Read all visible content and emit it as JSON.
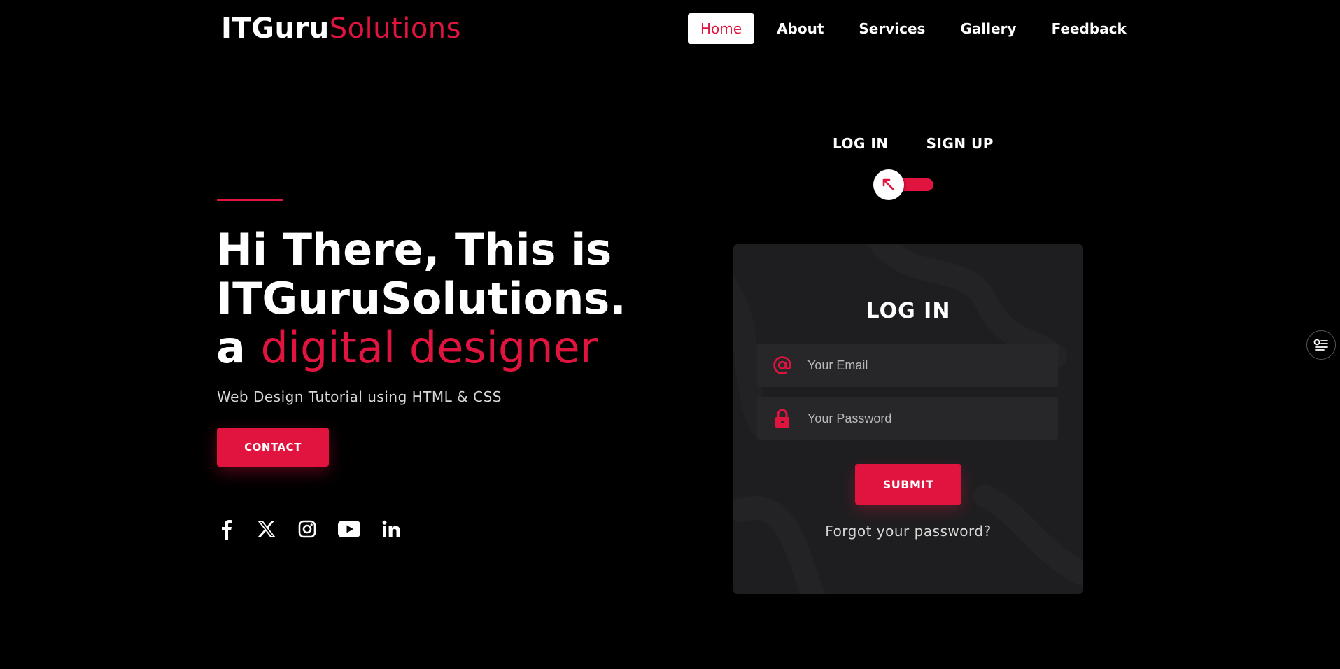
{
  "brand": {
    "name_part1": "ITGuru",
    "name_part2": "Solutions",
    "accent_color": "#e0143e"
  },
  "nav": {
    "items": [
      {
        "label": "Home",
        "active": true
      },
      {
        "label": "About"
      },
      {
        "label": "Services"
      },
      {
        "label": "Gallery"
      },
      {
        "label": "Feedback"
      }
    ]
  },
  "hero": {
    "line1": "Hi There, This is",
    "line2": "ITGuruSolutions.",
    "line3_prefix": "a ",
    "line3_accent": "digital designer",
    "subtitle": "Web Design Tutorial using HTML & CSS",
    "contact_label": "CONTACT"
  },
  "socials": [
    "facebook-icon",
    "x-icon",
    "instagram-icon",
    "youtube-icon",
    "linkedin-icon"
  ],
  "auth": {
    "login_tab": "LOG IN",
    "signup_tab": "SIGN UP",
    "card_title": "LOG IN",
    "email_placeholder": "Your Email",
    "password_placeholder": "Your Password",
    "submit_label": "SUBMIT",
    "forgot_label": "Forgot your password?"
  }
}
